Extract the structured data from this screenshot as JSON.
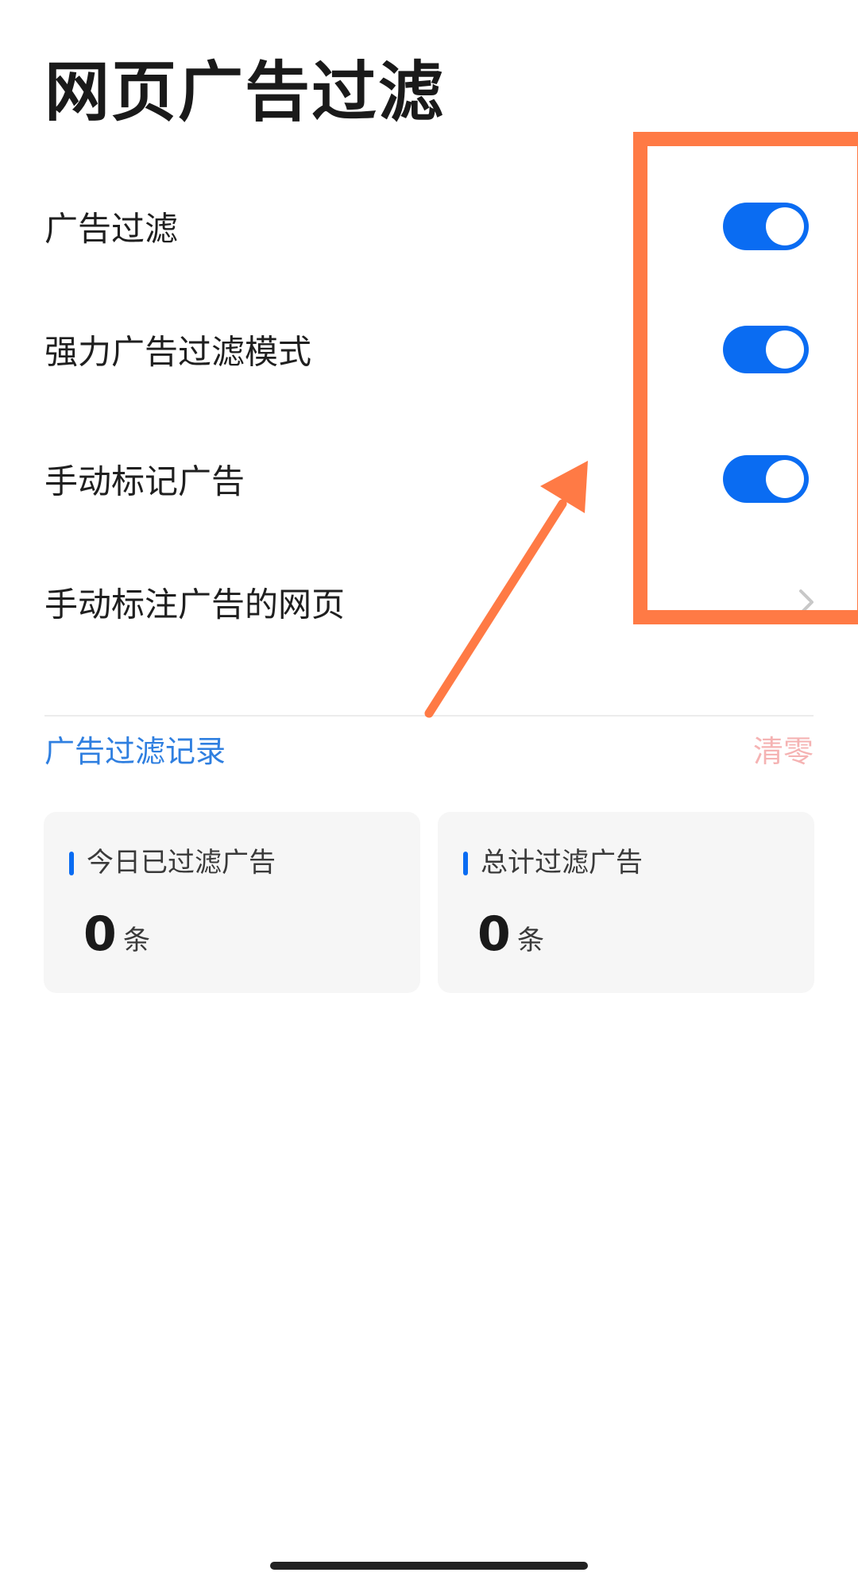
{
  "page": {
    "title": "网页广告过滤"
  },
  "settings": {
    "items": [
      {
        "label": "广告过滤",
        "control": "toggle",
        "on": true
      },
      {
        "label": "强力广告过滤模式",
        "control": "toggle",
        "on": true
      },
      {
        "label": "手动标记广告",
        "control": "toggle",
        "on": true
      },
      {
        "label": "手动标注广告的网页",
        "control": "chevron"
      }
    ]
  },
  "records": {
    "section_title": "广告过滤记录",
    "clear_label": "清零",
    "cards": [
      {
        "label": "今日已过滤广告",
        "value": "0",
        "unit": "条"
      },
      {
        "label": "总计过滤广告",
        "value": "0",
        "unit": "条"
      }
    ]
  },
  "annotation": {
    "highlight": "toggle-column",
    "color": "#ff7a45"
  },
  "colors": {
    "accent": "#0a6cf2",
    "section_title": "#2f7fe0",
    "clear": "#f5b3b3",
    "card_bg": "#f6f6f6"
  },
  "icons": {
    "chevron": "chevron-right-icon"
  }
}
